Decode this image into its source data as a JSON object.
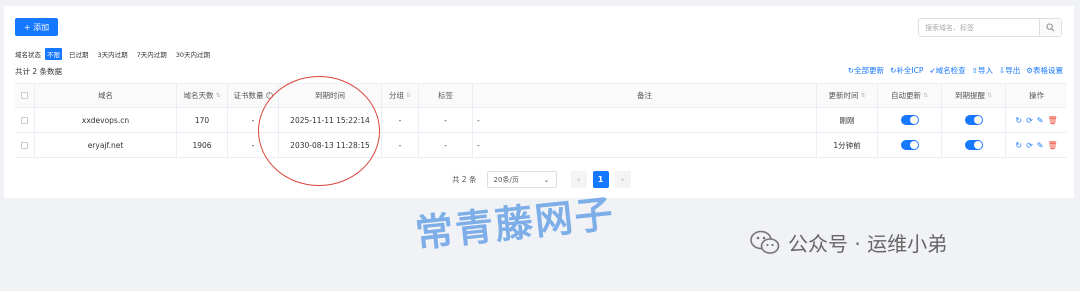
{
  "toolbar_top": {
    "add_label": "+ 添加",
    "search_placeholder": "搜索域名、标签"
  },
  "filter": {
    "label": "域名状态",
    "options": [
      "不限",
      "已过期",
      "3天内过期",
      "7天内过期",
      "30天内过期"
    ],
    "active_index": 0
  },
  "count_text": "共计 2 条数据",
  "actions": [
    "全部更新",
    "补全ICP",
    "域名检查",
    "导入",
    "导出",
    "表格设置"
  ],
  "table": {
    "columns": [
      "域名",
      "域名天数",
      "证书数量",
      "到期时间",
      "分组",
      "标签",
      "备注",
      "更新时间",
      "自动更新",
      "到期提醒",
      "操作"
    ],
    "rows": [
      {
        "domain": "xxdevops.cn",
        "days": "170",
        "certs": "-",
        "expire": "2025-11-11 15:22:14",
        "group": "-",
        "tag": "-",
        "note": "-",
        "updated": "刚刚",
        "auto_update": true,
        "remind": true
      },
      {
        "domain": "eryajf.net",
        "days": "1906",
        "certs": "-",
        "expire": "2030-08-13 11:28:15",
        "group": "-",
        "tag": "-",
        "note": "-",
        "updated": "1分钟前",
        "auto_update": true,
        "remind": true
      }
    ]
  },
  "pagination": {
    "total_text": "共 2 条",
    "page_size": "20条/页",
    "current_page": "1"
  },
  "watermark": {
    "text": "常青藤网子"
  },
  "wechat": {
    "text": "公众号 · 运维小弟"
  },
  "colors": {
    "primary": "#1677ff",
    "danger": "#ee4d3d",
    "circle": "#d9453a",
    "watermark": "#6aa3e6"
  }
}
